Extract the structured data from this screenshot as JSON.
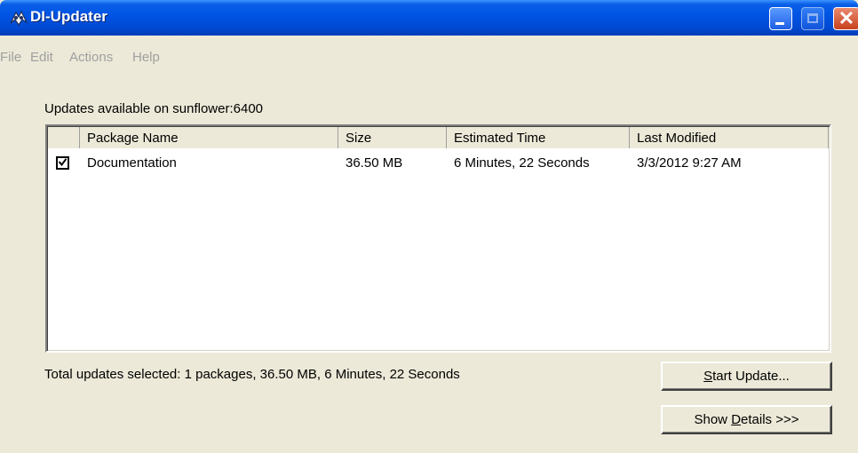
{
  "window": {
    "title": "DI-Updater",
    "controls": [
      "minimize",
      "maximize",
      "close"
    ]
  },
  "menu": [
    {
      "label": "File"
    },
    {
      "label": "Edit"
    },
    {
      "label": "Actions"
    },
    {
      "label": "Help"
    }
  ],
  "updates": {
    "label": "Updates available on sunflower:6400",
    "columns": [
      "",
      "Package Name",
      "Size",
      "Estimated Time",
      "Last Modified"
    ],
    "rows": [
      {
        "checked": true,
        "name": "Documentation",
        "size": "36.50 MB",
        "time": "6 Minutes, 22 Seconds",
        "modified": "3/3/2012 9:27 AM"
      }
    ]
  },
  "summary": "Total updates selected: 1 packages, 36.50 MB, 6 Minutes, 22 Seconds",
  "buttons": {
    "start_update": {
      "accel": "S",
      "rest": "tart Update..."
    },
    "show_details": {
      "pre": "Show ",
      "accel": "D",
      "rest": "etails >>>"
    }
  },
  "icons": {
    "app": "di-updater-app-icon",
    "check": "checkmark-icon"
  }
}
